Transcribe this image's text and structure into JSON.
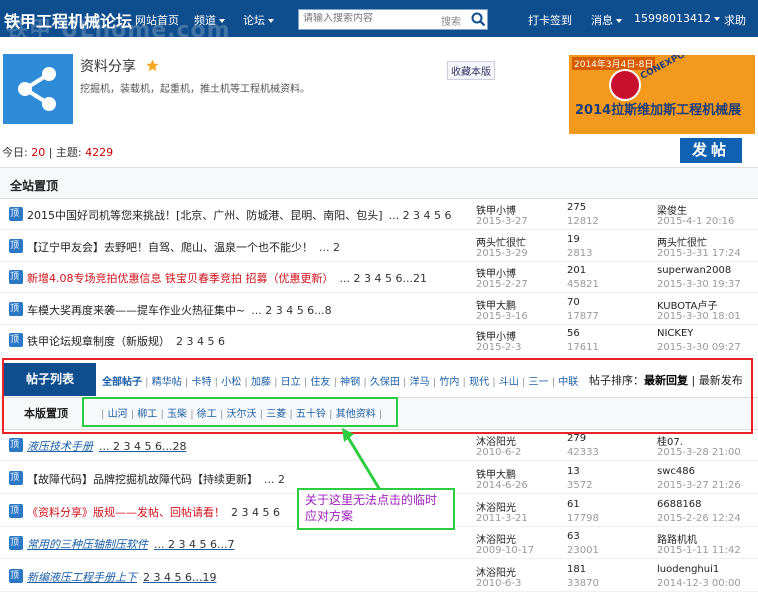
{
  "header": {
    "logo": "铁甲工程机械论坛",
    "watermark": "铁甲 ULhome.com",
    "nav": [
      {
        "label": "网站首页",
        "dropdown": false
      },
      {
        "label": "频道",
        "dropdown": true
      },
      {
        "label": "论坛",
        "dropdown": true
      }
    ],
    "search_placeholder": "请输入搜索内容",
    "search_label": "搜索",
    "checkin": "打卡签到",
    "messages": "消息",
    "phone": "15998013412",
    "help": "求助"
  },
  "forum": {
    "title": "资料分享",
    "desc": "挖掘机，装载机，起重机，推土机等工程机械资料。",
    "fav": "收藏本版",
    "banner_date": "2014年3月4日-8日",
    "banner_cn": "2014拉斯维加斯工程机械展",
    "banner_en": "CONEXPO-CON/AGG"
  },
  "stats": {
    "today_label": "今日:",
    "today": "20",
    "sep": " | ",
    "topics_label": "主题:",
    "topics": "4229"
  },
  "post_button": "发帖",
  "global_section": "全站置顶",
  "global_rows": [
    {
      "title": "2015中国好司机等您来挑战！[北京、广州、防城港、昆明、南阳、包头]",
      "pages": "... 2 3 4 5 6",
      "red": false,
      "blue": false,
      "author": "铁甲小博",
      "date": "2015-3-27",
      "replies": "275",
      "views": "12812",
      "last": "梁俊生",
      "last_date": "2015-4-1 20:16"
    },
    {
      "title": "【辽宁甲友会】去野吧！自驾、爬山、温泉一个也不能少！",
      "pages": "... 2",
      "red": false,
      "blue": false,
      "author": "两头忙很忙",
      "date": "2015-3-29",
      "replies": "19",
      "views": "2813",
      "last": "两头忙很忙",
      "last_date": "2015-3-31 17:24"
    },
    {
      "title": "新增4.08专场竞拍优惠信息 铁宝贝春季竞拍 招募（优惠更新）",
      "pages": "... 2 3 4 5 6...21",
      "red": true,
      "blue": false,
      "author": "铁甲小博",
      "date": "2015-2-27",
      "replies": "201",
      "views": "45821",
      "last": "superwan2008",
      "last_date": "2015-3-30 19:37"
    },
    {
      "title": "车模大奖再度来袭——提车作业火热征集中~",
      "pages": "... 2 3 4 5 6...8",
      "red": false,
      "blue": false,
      "author": "铁甲大鹏",
      "date": "2015-3-16",
      "replies": "70",
      "views": "17877",
      "last": "KUBOTA卢子",
      "last_date": "2015-3-30 18:01"
    },
    {
      "title": "铁甲论坛规章制度（新版规）",
      "pages": "2 3 4 5 6",
      "red": false,
      "blue": false,
      "author": "铁甲小博",
      "date": "2015-2-3",
      "replies": "56",
      "views": "17611",
      "last": "NICKEY",
      "last_date": "2015-3-30 09:27"
    }
  ],
  "list": {
    "tab": "帖子列表",
    "filters": [
      "全部帖子",
      "精华帖",
      "卡特",
      "小松",
      "加藤",
      "日立",
      "住友",
      "神钢",
      "久保田",
      "洋马",
      "竹内",
      "现代",
      "斗山",
      "三一",
      "中联"
    ],
    "sort_label": "帖子排序：",
    "sort_a": "最新回复",
    "sort_b": "最新发布",
    "sub_title": "本版置顶",
    "sub_cats": [
      "山河",
      "柳工",
      "玉柴",
      "徐工",
      "沃尔沃",
      "三菱",
      "五十铃",
      "其他资料"
    ]
  },
  "board_rows": [
    {
      "title": "液压技术手册",
      "pages": "... 2 3 4 5 6...28",
      "red": false,
      "blue": true,
      "author": "沐浴阳光",
      "date": "2010-6-2",
      "replies": "279",
      "views": "42333",
      "last": "桂07.",
      "last_date": "2015-3-28 21:00"
    },
    {
      "title": "【故障代码】品牌挖掘机故障代码【持续更新】",
      "pages": "... 2",
      "red": false,
      "blue": false,
      "author": "铁甲大鹏",
      "date": "2014-6-26",
      "replies": "13",
      "views": "3572",
      "last": "swc486",
      "last_date": "2015-3-27 21:26"
    },
    {
      "title": "《资料分享》版规——发帖、回帖请看！",
      "pages": "2 3 4 5 6",
      "red": true,
      "blue": false,
      "author": "沐浴阳光",
      "date": "2011-3-21",
      "replies": "61",
      "views": "17798",
      "last": "6688168",
      "last_date": "2015-2-26 12:24"
    },
    {
      "title": "常用的三种压轴制压软件",
      "pages": "... 2 3 4 5 6...7",
      "red": false,
      "blue": true,
      "author": "沐浴阳光",
      "date": "2009-10-17",
      "replies": "63",
      "views": "23001",
      "last": "路路机机",
      "last_date": "2015-1-11 11:42"
    },
    {
      "title": "新编液压工程手册上下",
      "pages": "2 3 4 5 6...19",
      "red": false,
      "blue": true,
      "author": "沐浴阳光",
      "date": "2010-6-3",
      "replies": "181",
      "views": "33870",
      "last": "luodenghui1",
      "last_date": "2014-12-3 00:00"
    }
  ],
  "annotation": "关于这里无法点击的临时应对方案",
  "colors": {
    "header_bg": "#0e4d8e",
    "accent": "#1161b3",
    "red_box": "#e8232a",
    "green_box": "#2ecc40",
    "annotation_text": "#a020c0"
  }
}
